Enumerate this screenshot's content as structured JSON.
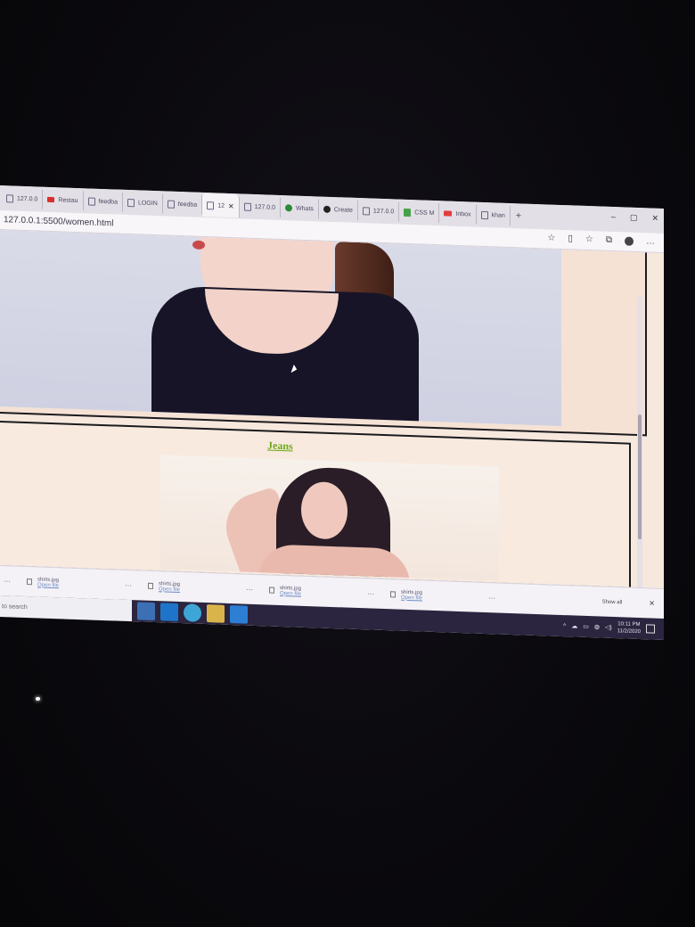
{
  "tabs": [
    {
      "label": "127.0.0",
      "icon": "page-icon"
    },
    {
      "label": "Restau",
      "icon": "red-app-icon"
    },
    {
      "label": "feedba",
      "icon": "page-icon"
    },
    {
      "label": "LOGIN",
      "icon": "page-icon"
    },
    {
      "label": "feedba",
      "icon": "page-icon"
    },
    {
      "label": "12",
      "icon": "page-icon",
      "active": true
    },
    {
      "label": "127.0.0",
      "icon": "page-icon"
    },
    {
      "label": "Whats",
      "icon": "whatsapp-icon"
    },
    {
      "label": "Create",
      "icon": "github-icon"
    },
    {
      "label": "127.0.0",
      "icon": "page-icon"
    },
    {
      "label": "CSS M",
      "icon": "css-icon"
    },
    {
      "label": "Inbox",
      "icon": "gmail-icon"
    },
    {
      "label": "khan",
      "icon": "page-icon"
    }
  ],
  "address_bar": {
    "url": "127.0.0.1:5500/women.html"
  },
  "page": {
    "section_title": "Jeans"
  },
  "downloads": {
    "items": [
      {
        "name": "shirts.jpg",
        "action": "Open file"
      },
      {
        "name": "shirts.jpg",
        "action": "Open file"
      },
      {
        "name": "shirts.jpg",
        "action": "Open file"
      },
      {
        "name": "shirts.jpg",
        "action": "Open file"
      }
    ],
    "show_all": "Show all"
  },
  "taskbar": {
    "search_placeholder": "to search",
    "time": "10:11 PM",
    "date": "11/2/2020"
  },
  "colors": {
    "section_title": "#6fa81d",
    "taskbar": "#2b2540"
  }
}
